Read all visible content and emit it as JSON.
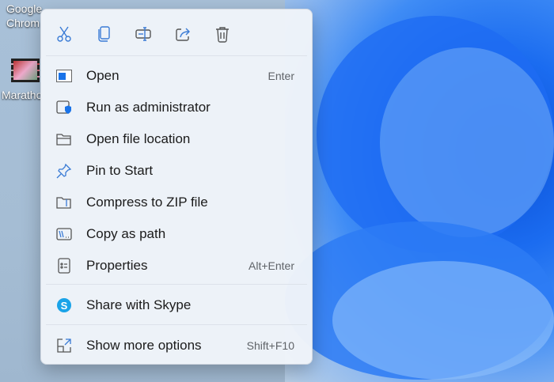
{
  "desktop": {
    "icons": [
      {
        "label_lines": [
          "Google",
          "Chrom"
        ]
      },
      {
        "label": "Maratho"
      }
    ]
  },
  "toolbar": [
    {
      "name": "cut"
    },
    {
      "name": "copy"
    },
    {
      "name": "rename"
    },
    {
      "name": "share"
    },
    {
      "name": "delete"
    }
  ],
  "items": [
    {
      "label": "Open",
      "shortcut": "Enter"
    },
    {
      "label": "Run as administrator",
      "shortcut": ""
    },
    {
      "label": "Open file location",
      "shortcut": ""
    },
    {
      "label": "Pin to Start",
      "shortcut": ""
    },
    {
      "label": "Compress to ZIP file",
      "shortcut": ""
    },
    {
      "label": "Copy as path",
      "shortcut": ""
    },
    {
      "label": "Properties",
      "shortcut": "Alt+Enter"
    },
    {
      "label": "Share with Skype",
      "shortcut": ""
    },
    {
      "label": "Show more options",
      "shortcut": "Shift+F10"
    }
  ],
  "colors": {
    "accent": "#1a73e8",
    "skype": "#1aa3e8"
  }
}
